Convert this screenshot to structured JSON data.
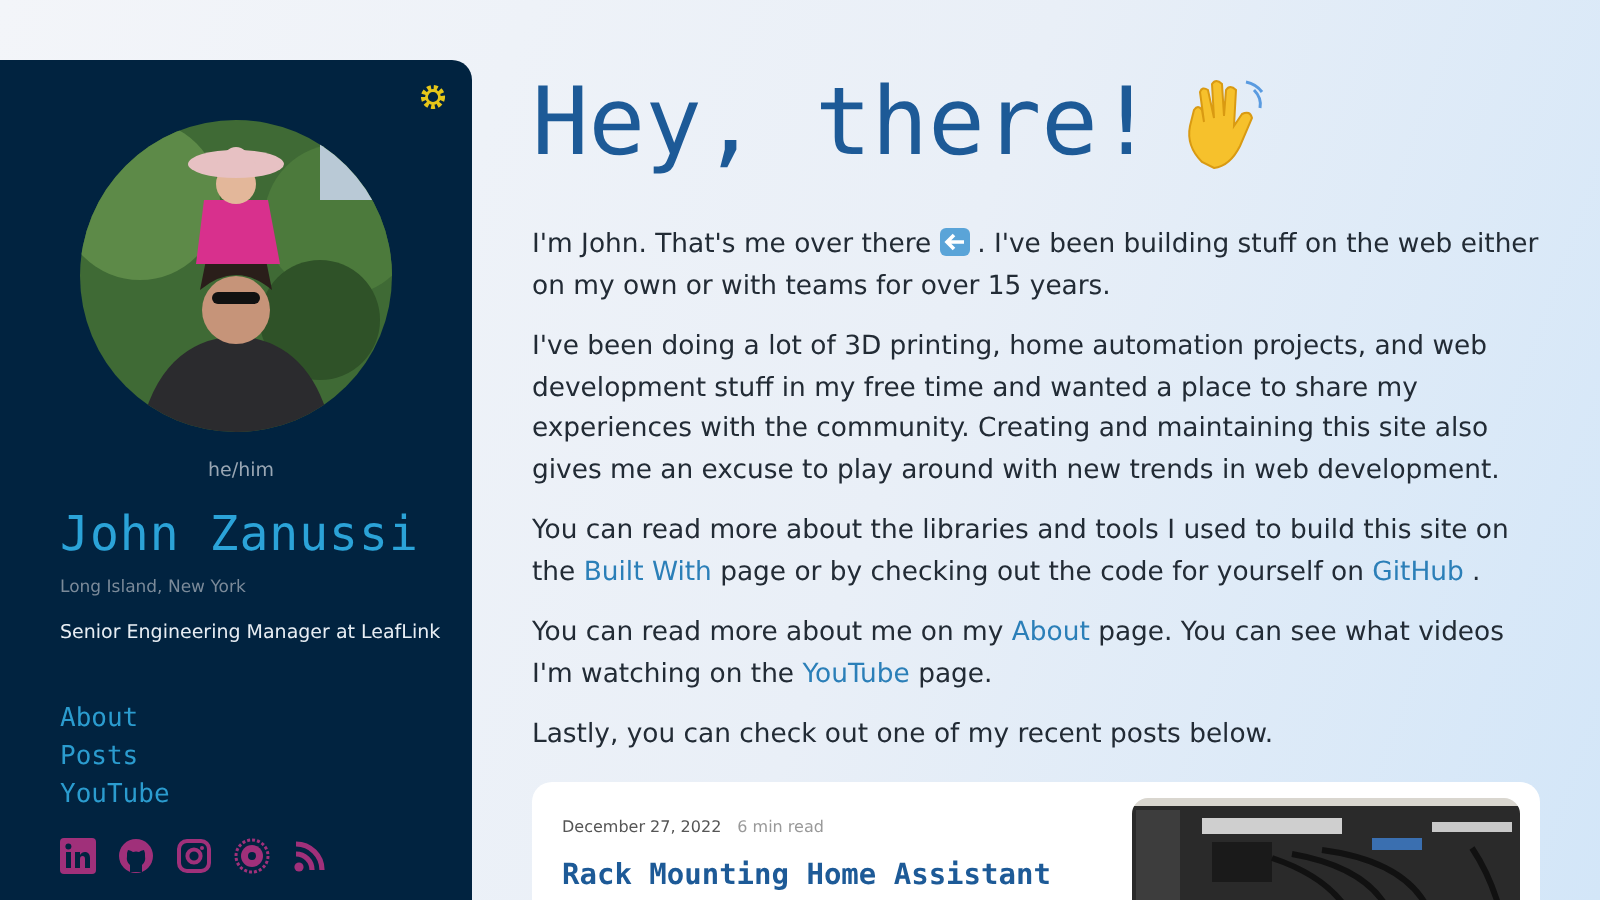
{
  "sidebar": {
    "pronouns": "he/him",
    "name": "John Zanussi",
    "location": "Long Island, New York",
    "job_title": "Senior Engineering Manager at LeafLink",
    "nav": [
      {
        "label": "About"
      },
      {
        "label": "Posts"
      },
      {
        "label": "YouTube"
      }
    ]
  },
  "main": {
    "heading": "Hey, there!",
    "paragraphs": [
      [
        {
          "kind": "text",
          "text": "I'm John. That's me over there"
        },
        {
          "kind": "icon"
        },
        {
          "kind": "text",
          "text": ". I've been building stuff on the web either on my own or with teams for over 15 years."
        }
      ],
      [
        {
          "kind": "text",
          "text": "I've been doing a lot of 3D printing, home automation projects, and web development stuff in my free time and wanted a place to share my experiences with the community. Creating and maintaining this site also gives me an excuse to play around with new trends in web development."
        }
      ],
      [
        {
          "kind": "text",
          "text": "You can read more about the libraries and tools I used to build this site on the "
        },
        {
          "kind": "link",
          "text": "Built With"
        },
        {
          "kind": "text",
          "text": " page or by checking out the code for yourself on "
        },
        {
          "kind": "link",
          "text": "GitHub"
        },
        {
          "kind": "text",
          "text": " ."
        }
      ],
      [
        {
          "kind": "text",
          "text": "You can read more about me on my "
        },
        {
          "kind": "link",
          "text": "About"
        },
        {
          "kind": "text",
          "text": " page. You can see what videos I'm watching on the "
        },
        {
          "kind": "link",
          "text": "YouTube"
        },
        {
          "kind": "text",
          "text": " page."
        }
      ],
      [
        {
          "kind": "text",
          "text": "Lastly, you can check out one of my recent posts below."
        }
      ]
    ],
    "post": {
      "date": "December 27, 2022",
      "read_time": "6 min read",
      "title": "Rack Mounting Home Assistant"
    }
  }
}
